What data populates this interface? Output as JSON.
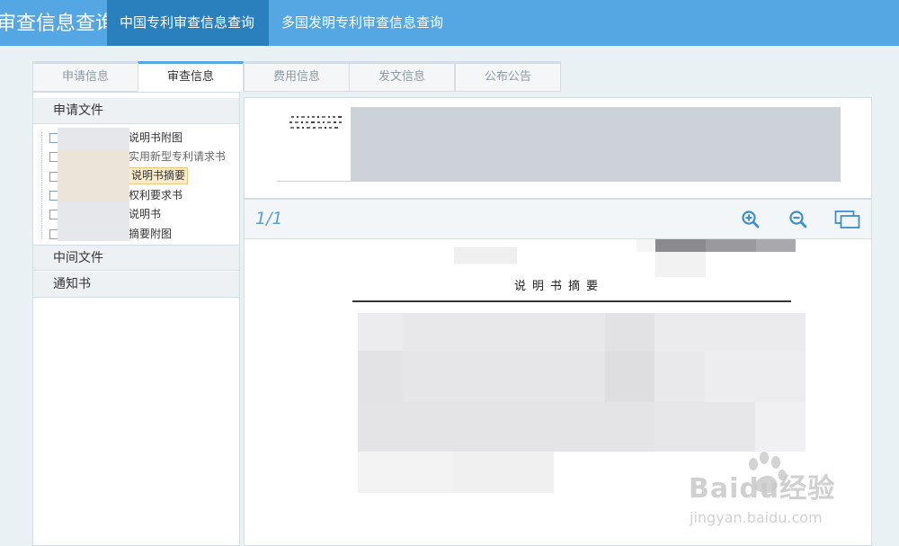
{
  "header": {
    "brand": "审查信息查询",
    "nav": [
      "中国专利审查信息查询",
      "多国发明专利审查信息查询"
    ]
  },
  "tabs": [
    "申请信息",
    "审查信息",
    "费用信息",
    "发文信息",
    "公布公告"
  ],
  "left_panel": {
    "sections": [
      "申请文件",
      "中间文件",
      "通知书"
    ],
    "tree_items": [
      "说明书附图",
      "实用新型专利请求书",
      "说明书摘要",
      "权利要求书",
      "说明书",
      "摘要附图"
    ],
    "selected_item": "说明书摘要"
  },
  "document": {
    "page_indicator": "1/1",
    "title": "说明书摘要"
  },
  "watermark": {
    "logo_text": "Baidu经验",
    "url": "jingyan.baidu.com"
  },
  "colors": {
    "topbar": "#55a7e3",
    "nav_active": "#2a7fbd",
    "tab_active_border": "#55a7e3",
    "icon_blue": "#3b8fd0"
  }
}
